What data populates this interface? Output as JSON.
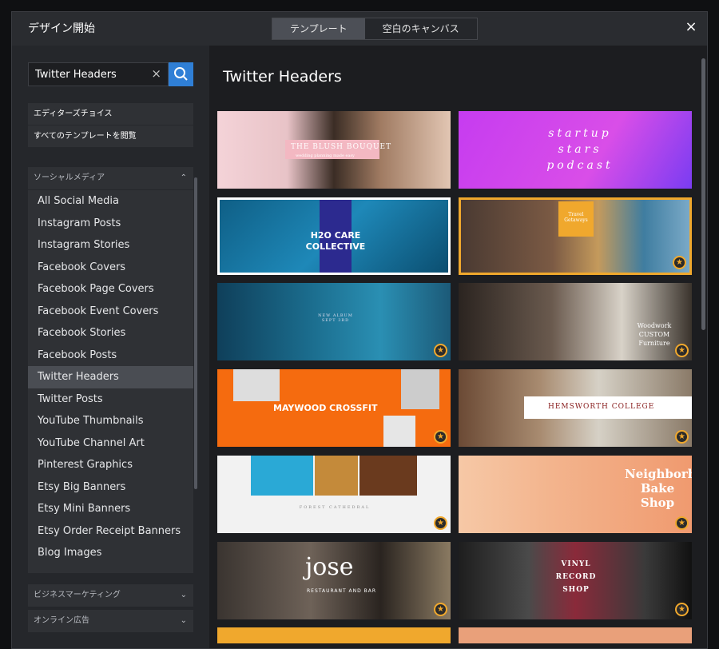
{
  "dialog": {
    "title": "デザイン開始",
    "tabs": [
      "テンプレート",
      "空白のキャンバス"
    ],
    "close_label": "×"
  },
  "sidebar": {
    "search_value": "Twitter Headers",
    "clear_label": "×",
    "links": [
      "エディターズチョイス",
      "すべてのテンプレートを閲覧"
    ],
    "section_social": "ソーシャルメディア",
    "items": [
      "All Social Media",
      "Instagram Posts",
      "Instagram Stories",
      "Facebook Covers",
      "Facebook Page Covers",
      "Facebook Event Covers",
      "Facebook Stories",
      "Facebook Posts",
      "Twitter Headers",
      "Twitter Posts",
      "YouTube Thumbnails",
      "YouTube Channel Art",
      "Pinterest Graphics",
      "Etsy Big Banners",
      "Etsy Mini Banners",
      "Etsy Order Receipt Banners",
      "Blog Images"
    ],
    "selected_item": "Twitter Headers",
    "section_business": "ビジネスマーケティング",
    "section_ads": "オンライン広告"
  },
  "main": {
    "heading": "Twitter Headers",
    "templates": [
      {
        "text": "THE BLUSH BOUQUET",
        "sub": "wedding planning made easy",
        "premium": false
      },
      {
        "text": "startup stars podcast",
        "premium": false
      },
      {
        "text": "H2O CARE COLLECTIVE",
        "premium": false
      },
      {
        "text": "Travel Getaways",
        "premium": true
      },
      {
        "text": "NEW ALBUM SEPT 3RD",
        "premium": true
      },
      {
        "text": "Woodwork CUSTOM Furniture",
        "premium": true
      },
      {
        "text": "MAYWOOD CROSSFIT",
        "premium": true
      },
      {
        "text": "HEMSWORTH COLLEGE",
        "premium": true
      },
      {
        "text": "FOREST CATHEDRAL",
        "premium": true
      },
      {
        "text": "Neighborhood Bake Shop",
        "premium": true
      },
      {
        "text": "jose",
        "sub": "RESTAURANT AND BAR",
        "premium": true
      },
      {
        "text": "VINYL RECORD SHOP",
        "premium": true
      }
    ]
  },
  "colors": {
    "accent": "#2f7fd6",
    "premium_star": "#f0a82d",
    "selected_bg": "#4a4d53"
  }
}
